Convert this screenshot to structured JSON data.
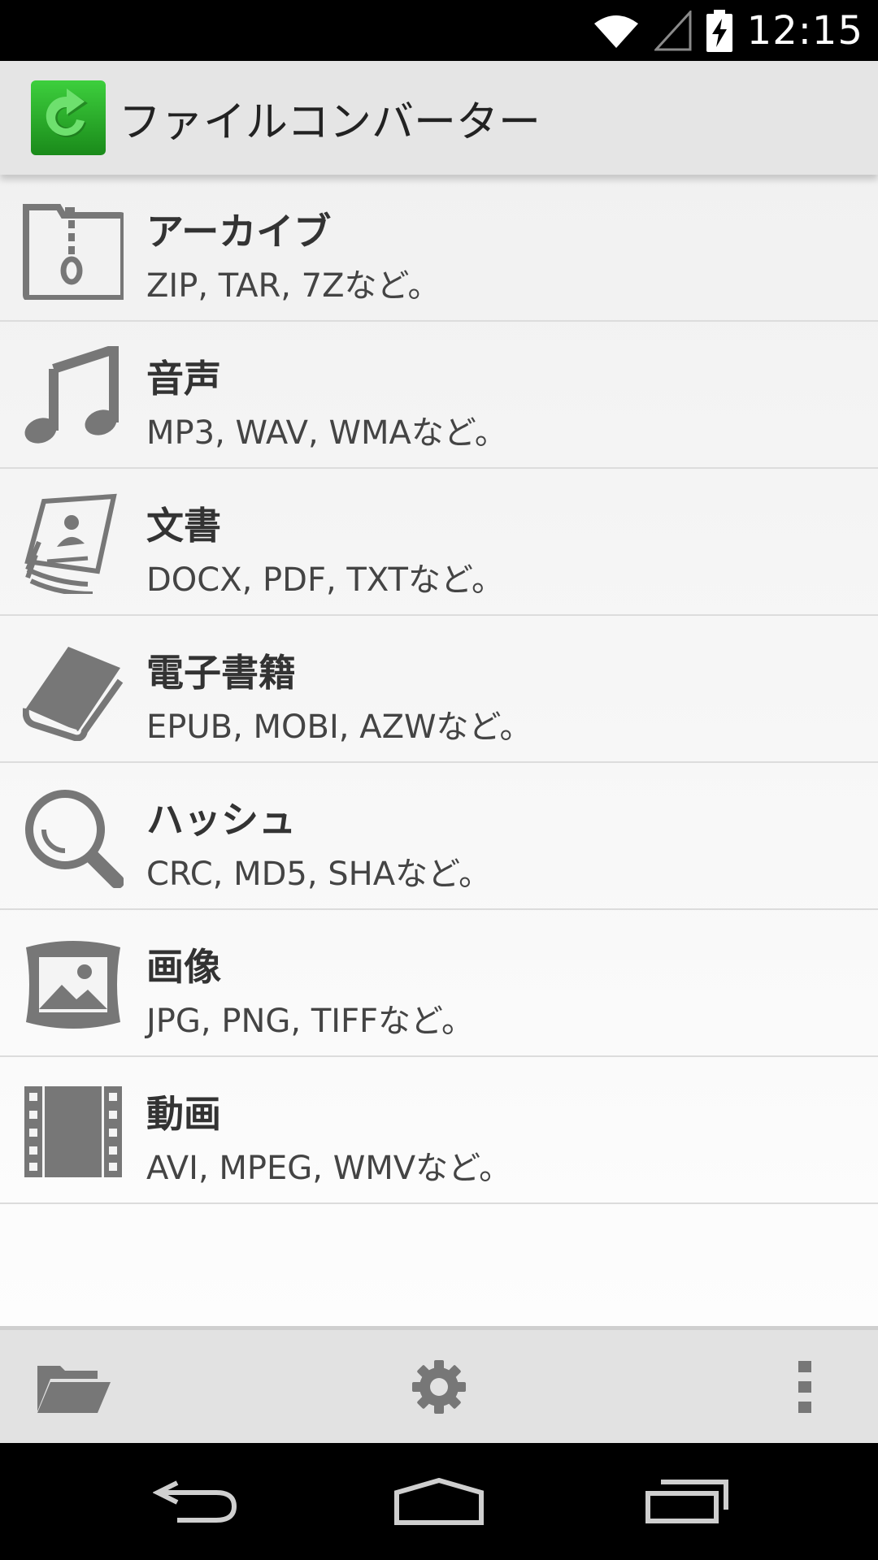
{
  "status": {
    "time": "12:15"
  },
  "appbar": {
    "title": "ファイルコンバーター"
  },
  "items": [
    {
      "title": "アーカイブ",
      "subtitle": "ZIP, TAR, 7Zなど。",
      "icon": "archive-icon"
    },
    {
      "title": "音声",
      "subtitle": "MP3, WAV, WMAなど。",
      "icon": "music-note-icon"
    },
    {
      "title": "文書",
      "subtitle": "DOCX, PDF, TXTなど。",
      "icon": "documents-icon"
    },
    {
      "title": "電子書籍",
      "subtitle": "EPUB, MOBI, AZWなど。",
      "icon": "book-icon"
    },
    {
      "title": "ハッシュ",
      "subtitle": "CRC, MD5, SHAなど。",
      "icon": "magnifier-icon"
    },
    {
      "title": "画像",
      "subtitle": "JPG, PNG, TIFFなど。",
      "icon": "picture-icon"
    },
    {
      "title": "動画",
      "subtitle": "AVI, MPEG, WMVなど。",
      "icon": "film-icon"
    }
  ],
  "bottombar": {
    "icons": [
      "folder-icon",
      "gear-icon",
      "overflow-menu-icon"
    ]
  },
  "navbar": {
    "icons": [
      "back-icon",
      "home-icon",
      "recents-icon"
    ]
  },
  "colors": {
    "icon_gray": "#777777",
    "accent_green": "#2fb52f"
  }
}
